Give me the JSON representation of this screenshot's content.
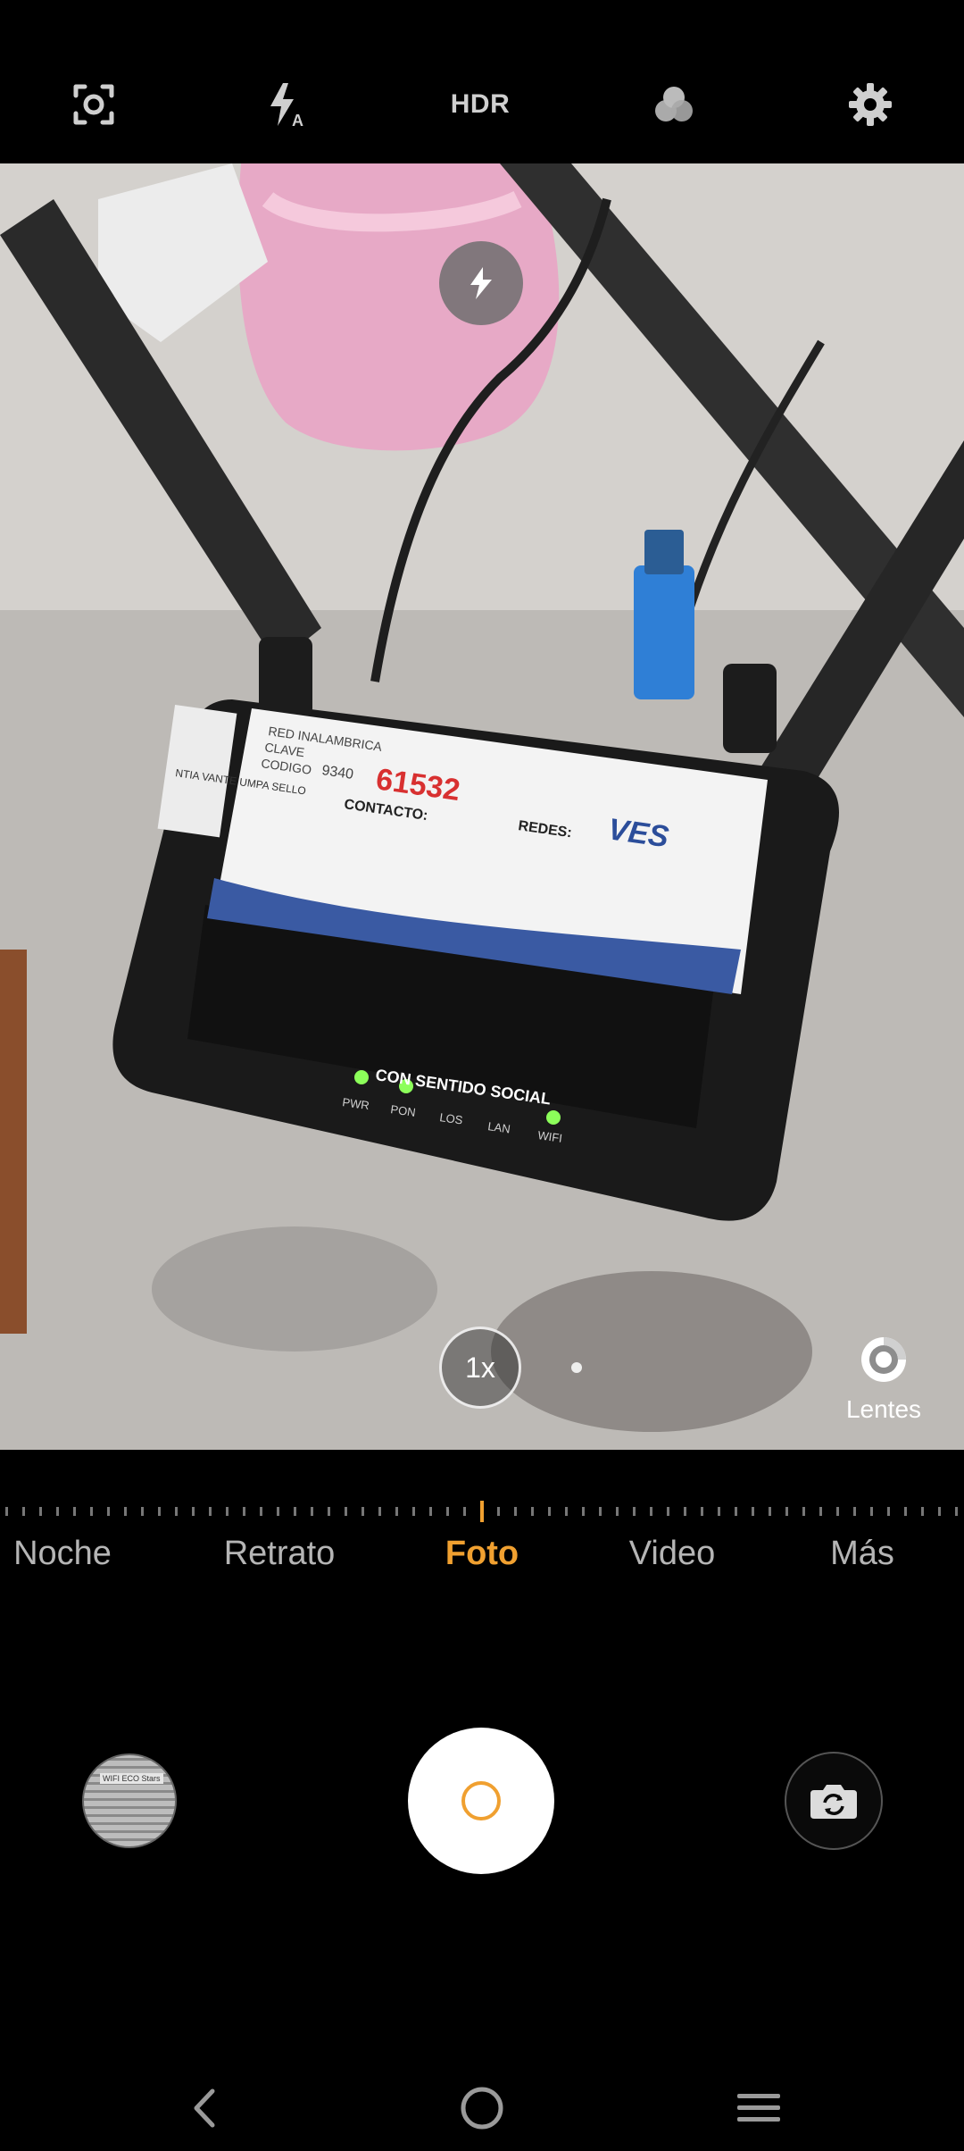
{
  "toolbar": {
    "hdr_label": "HDR",
    "icons": [
      "focus-scan-icon",
      "flash-auto-icon",
      "filters-icon",
      "settings-icon"
    ]
  },
  "viewfinder": {
    "flash_indicator_icon": "flash-icon",
    "zoom_label": "1x",
    "lens_label": "Lentes"
  },
  "modes": [
    {
      "label": "Noche",
      "active": false
    },
    {
      "label": "Retrato",
      "active": false
    },
    {
      "label": "Foto",
      "active": true
    },
    {
      "label": "Video",
      "active": false
    },
    {
      "label": "Más",
      "active": false
    }
  ],
  "gallery_thumbnail": {
    "caption": "WIFI ECO Stars"
  },
  "router_card": {
    "red_label": "RED INALAMBRICA",
    "clave_label": "CLAVE",
    "codigo_label": "CODIGO",
    "codigo_value": "9340",
    "handwritten": "61532",
    "contacto": "CONTACTO:",
    "redes": "REDES:",
    "brand": "VES",
    "slogan": "CON SENTIDO SOCIAL",
    "side_label": "NTIA VANTE UMPA SELLO"
  },
  "router_leds": [
    "PWR",
    "PON",
    "LOS",
    "LAN",
    "WIFI"
  ],
  "colors": {
    "accent": "#f0a030",
    "background": "#000000",
    "inactive_text": "#b5b5b5"
  }
}
